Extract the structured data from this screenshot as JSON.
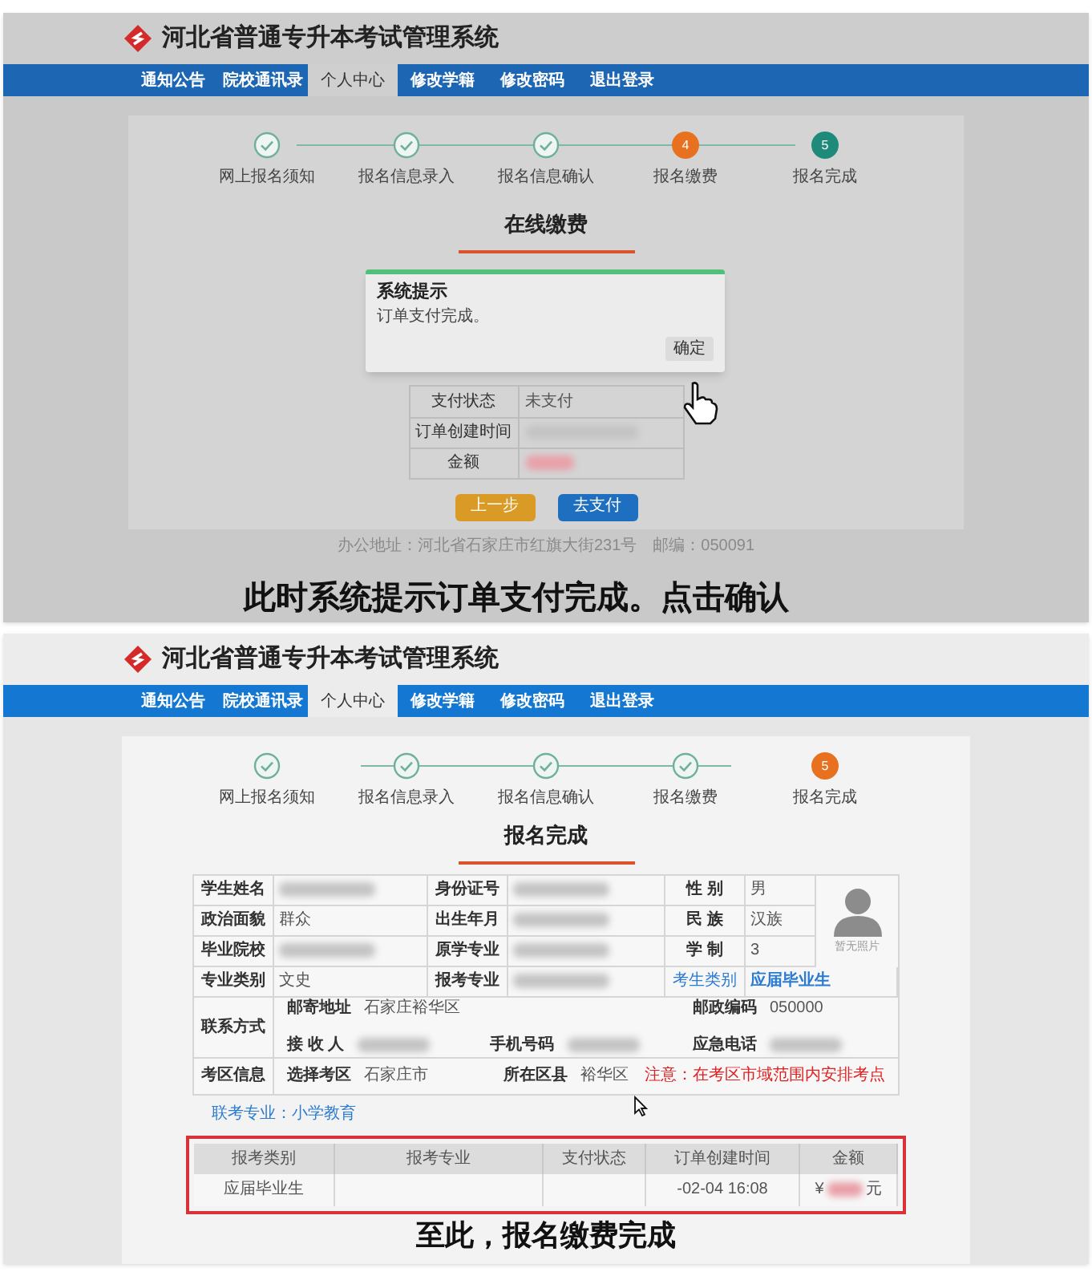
{
  "payment_screen": {
    "header": {
      "title": "河北省普通专升本考试管理系统"
    },
    "nav": [
      {
        "label": "通知公告",
        "selected": false
      },
      {
        "label": "院校通讯录",
        "selected": false
      },
      {
        "label": "个人中心",
        "selected": true
      },
      {
        "label": "修改学籍",
        "selected": false
      },
      {
        "label": "修改密码",
        "selected": false
      },
      {
        "label": "退出登录",
        "selected": false
      }
    ],
    "steps": [
      {
        "label": "网上报名须知",
        "done": true
      },
      {
        "label": "报名信息录入",
        "done": true
      },
      {
        "label": "报名信息确认",
        "done": true
      },
      {
        "label": "报名缴费",
        "done": false,
        "current": true,
        "number": "4"
      },
      {
        "label": "报名完成",
        "done": false,
        "current": false,
        "number": "5"
      }
    ],
    "section_title": "在线缴费",
    "payment_table": [
      {
        "label": "支付状态",
        "value": "未支付"
      },
      {
        "label": "订单创建时间",
        "blurred": true
      },
      {
        "label": "金额",
        "blurred": true,
        "kind": "amount"
      }
    ],
    "buttons": [
      {
        "label": "上一步",
        "kind": "secondary"
      },
      {
        "label": "去支付",
        "kind": "primary"
      }
    ],
    "dialog": {
      "title": "系统提示",
      "message": "订单支付完成。",
      "button": "确定"
    },
    "footer": "办公地址：河北省石家庄市红旗大街231号　邮编：050091",
    "caption": "此时系统提示订单支付完成。点击确认"
  },
  "completion_screen": {
    "header": {
      "title": "河北省普通专升本考试管理系统"
    },
    "nav": [
      {
        "label": "通知公告",
        "selected": false
      },
      {
        "label": "院校通讯录",
        "selected": false
      },
      {
        "label": "个人中心",
        "selected": true
      },
      {
        "label": "修改学籍",
        "selected": false
      },
      {
        "label": "修改密码",
        "selected": false
      },
      {
        "label": "退出登录",
        "selected": false
      }
    ],
    "steps": [
      {
        "label": "网上报名须知",
        "done": true
      },
      {
        "label": "报名信息录入",
        "done": true
      },
      {
        "label": "报名信息确认",
        "done": true
      },
      {
        "label": "报名缴费",
        "done": true
      },
      {
        "label": "报名完成",
        "done": false,
        "current": true,
        "number": "5"
      }
    ],
    "section_title": "报名完成",
    "profile_rows": [
      [
        {
          "kind": "label",
          "text": "学生姓名"
        },
        {
          "kind": "value",
          "blurred": true
        },
        {
          "kind": "label",
          "text": "身份证号"
        },
        {
          "kind": "value",
          "blurred": true
        },
        {
          "kind": "label",
          "text": "性 别"
        },
        {
          "kind": "value",
          "text": "男"
        }
      ],
      [
        {
          "kind": "label",
          "text": "政治面貌"
        },
        {
          "kind": "value",
          "text": "群众"
        },
        {
          "kind": "label",
          "text": "出生年月"
        },
        {
          "kind": "value",
          "blurred": true
        },
        {
          "kind": "label",
          "text": "民 族"
        },
        {
          "kind": "value",
          "text": "汉族"
        }
      ],
      [
        {
          "kind": "label",
          "text": "毕业院校"
        },
        {
          "kind": "value",
          "blurred": true
        },
        {
          "kind": "label",
          "text": "原学专业"
        },
        {
          "kind": "value",
          "blurred": true
        },
        {
          "kind": "label",
          "text": "学 制"
        },
        {
          "kind": "value",
          "text": "3"
        }
      ],
      [
        {
          "kind": "label",
          "text": "专业类别"
        },
        {
          "kind": "value",
          "text": "文史"
        },
        {
          "kind": "label",
          "text": "报考专业"
        },
        {
          "kind": "value",
          "blurred": true
        },
        {
          "kind": "link_label",
          "text": "考生类别"
        },
        {
          "kind": "link",
          "text": "应届毕业生"
        }
      ]
    ],
    "photo_caption": "暂无照片",
    "contact": {
      "label": "联系方式",
      "lines": [
        [
          {
            "label": "邮寄地址",
            "value": "石家庄裕华区"
          },
          {
            "label": "邮政编码",
            "value": "050000"
          }
        ],
        [
          {
            "label": "接 收 人",
            "blurred": true
          },
          {
            "label": "手机号码",
            "blurred": true
          },
          {
            "label": "应急电话",
            "blurred": true
          }
        ]
      ]
    },
    "exam_area": {
      "label": "考区信息",
      "items": [
        {
          "label": "选择考区",
          "value": "石家庄市"
        },
        {
          "label": "所在区县",
          "value": "裕华区"
        }
      ],
      "notice": "注意：在考区市域范围内安排考点"
    },
    "joint_major": "联考专业：小学教育",
    "order_table": {
      "columns": [
        "报考类别",
        "报考专业",
        "支付状态",
        "订单创建时间",
        "金额"
      ],
      "rows": [
        [
          {
            "kind": "text",
            "text": "应届毕业生"
          },
          {
            "kind": "covered"
          },
          {
            "kind": "covered"
          },
          {
            "kind": "text",
            "text": "-02-04 16:08"
          },
          {
            "kind": "amount",
            "prefix": "¥",
            "suffix": "元"
          }
        ]
      ]
    },
    "caption": "至此，报名缴费完成"
  }
}
